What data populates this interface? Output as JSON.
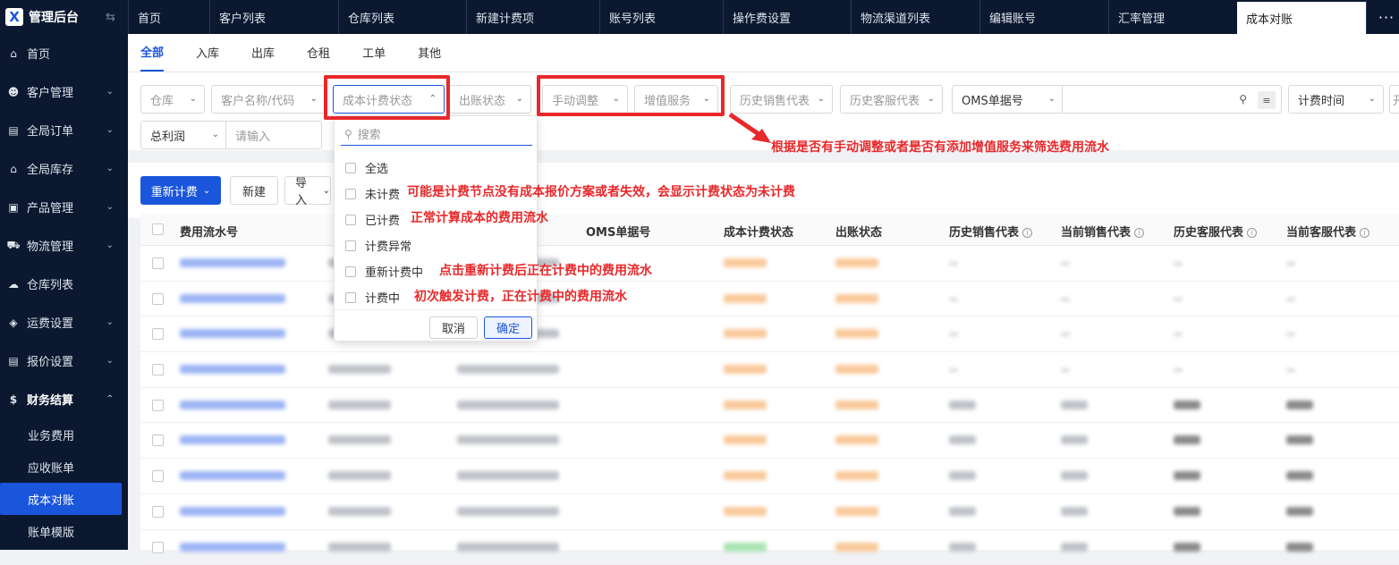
{
  "app": {
    "logo": "X",
    "title": "管理后台",
    "collapse_icon": "⇆"
  },
  "sidebar": {
    "items": [
      {
        "label": "首页",
        "icon": "home-icon",
        "glyph": "⌂",
        "expandable": false
      },
      {
        "label": "客户管理",
        "icon": "users-icon",
        "glyph": "☻",
        "expandable": true
      },
      {
        "label": "全局订单",
        "icon": "clipboard-icon",
        "glyph": "▤",
        "expandable": true
      },
      {
        "label": "全局库存",
        "icon": "warehouse-icon",
        "glyph": "⌂",
        "expandable": true
      },
      {
        "label": "产品管理",
        "icon": "product-icon",
        "glyph": "▣",
        "expandable": true
      },
      {
        "label": "物流管理",
        "icon": "truck-icon",
        "glyph": "⛟",
        "expandable": true
      },
      {
        "label": "仓库列表",
        "icon": "cloud-icon",
        "glyph": "☁",
        "expandable": false
      },
      {
        "label": "运费设置",
        "icon": "layers-icon",
        "glyph": "◈",
        "expandable": true
      },
      {
        "label": "报价设置",
        "icon": "document-icon",
        "glyph": "▤",
        "expandable": true
      },
      {
        "label": "财务结算",
        "icon": "dollar-icon",
        "glyph": "$",
        "expandable": true,
        "open": true
      }
    ],
    "sub_items": [
      {
        "label": "业务费用"
      },
      {
        "label": "应收账单"
      },
      {
        "label": "成本对账",
        "active": true
      },
      {
        "label": "账单模版"
      }
    ]
  },
  "page_tabs": [
    "首页",
    "客户列表",
    "仓库列表",
    "新建计费项",
    "账号列表",
    "操作费设置",
    "物流渠道列表",
    "编辑账号",
    "汇率管理",
    "成本对账"
  ],
  "page_tabs_more": "···",
  "sub_tabs": [
    "全部",
    "入库",
    "出库",
    "仓租",
    "工单",
    "其他"
  ],
  "filters": {
    "warehouse": "仓库",
    "customer": "客户名称/代码",
    "cost_status": "成本计费状态",
    "bill_status": "出账状态",
    "manual_adjust": "手动调整",
    "value_added": "增值服务",
    "hist_sales": "历史销售代表",
    "hist_cs": "历史客服代表",
    "oms_type": "OMS单据号",
    "oms_input": "",
    "time_type": "计费时间",
    "time_cut": "开",
    "profit_type": "总利润",
    "profit_placeholder": "请输入"
  },
  "toolbar": {
    "recharge": "重新计费",
    "new": "新建",
    "import": "导入"
  },
  "table": {
    "headers": [
      "费用流水号",
      "OMS单据号",
      "成本计费状态",
      "出账状态",
      "历史销售代表",
      "当前销售代表",
      "历史客服代表",
      "当前客服代表"
    ],
    "row_count": 9
  },
  "dropdown": {
    "search_placeholder": "搜索",
    "options": [
      "全选",
      "未计费",
      "已计费",
      "计费异常",
      "重新计费中",
      "计费中"
    ],
    "cancel": "取消",
    "confirm": "确定"
  },
  "annotations": {
    "filter_note": "根据是否有手动调整或者是否有添加增值服务来筛选费用流水",
    "unbilled": "可能是计费节点没有成本报价方案或者失效，会显示计费状态为未计费",
    "billed": "正常计算成本的费用流水",
    "recharging": "点击重新计费后正在计费中的费用流水",
    "billing": "初次触发计费，正在计费中的费用流水"
  },
  "colors": {
    "primary": "#1a56db",
    "sidebar_bg": "#0b1830",
    "annotation_red": "#e8282a"
  }
}
